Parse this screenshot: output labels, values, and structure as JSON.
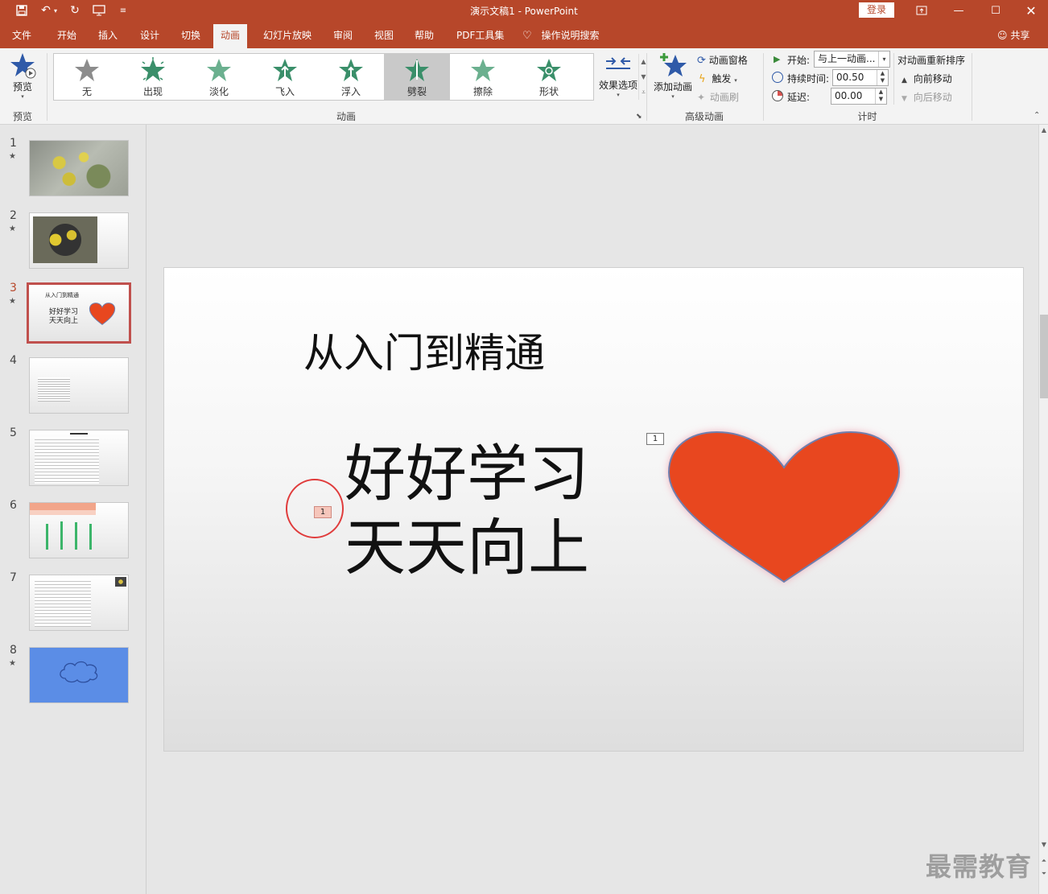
{
  "window": {
    "title": "演示文稿1  -  PowerPoint",
    "login_label": "登录"
  },
  "tabs": [
    {
      "label": "文件"
    },
    {
      "label": "开始"
    },
    {
      "label": "插入"
    },
    {
      "label": "设计"
    },
    {
      "label": "切换"
    },
    {
      "label": "动画",
      "active": true
    },
    {
      "label": "幻灯片放映"
    },
    {
      "label": "审阅"
    },
    {
      "label": "视图"
    },
    {
      "label": "帮助"
    },
    {
      "label": "PDF工具集"
    },
    {
      "label": "操作说明搜索"
    }
  ],
  "share_label": "共享",
  "ribbon": {
    "preview": {
      "button": "预览",
      "group": "预览"
    },
    "animations": {
      "group": "动画",
      "items": [
        {
          "label": "无",
          "icon": "star-gray-icon"
        },
        {
          "label": "出现",
          "icon": "star-burst-icon"
        },
        {
          "label": "淡化",
          "icon": "star-fade-icon"
        },
        {
          "label": "飞入",
          "icon": "star-fly-icon"
        },
        {
          "label": "浮入",
          "icon": "star-float-icon"
        },
        {
          "label": "劈裂",
          "icon": "star-split-icon",
          "selected": true
        },
        {
          "label": "擦除",
          "icon": "star-wipe-icon"
        },
        {
          "label": "形状",
          "icon": "star-shape-icon"
        }
      ],
      "effect_options": "效果选项"
    },
    "advanced": {
      "group": "高级动画",
      "add_animation": "添加动画",
      "pane": "动画窗格",
      "trigger": "触发",
      "painter": "动画刷"
    },
    "timing": {
      "group": "计时",
      "start_label": "开始:",
      "start_value": "与上一动画...",
      "duration_label": "持续时间:",
      "duration_value": "00.50",
      "delay_label": "延迟:",
      "delay_value": "00.00",
      "reorder": "对动画重新排序",
      "move_earlier": "向前移动",
      "move_later": "向后移动"
    }
  },
  "thumbnails": [
    {
      "number": "1",
      "star": true
    },
    {
      "number": "2",
      "star": true
    },
    {
      "number": "3",
      "star": true,
      "selected": true,
      "title": "从入门到精通",
      "line1": "好好学习",
      "line2": "天天向上"
    },
    {
      "number": "4",
      "star": false
    },
    {
      "number": "5",
      "star": false
    },
    {
      "number": "6",
      "star": false
    },
    {
      "number": "7",
      "star": false
    },
    {
      "number": "8",
      "star": true
    }
  ],
  "slide": {
    "title": "从入门到精通",
    "line1": "好好学习",
    "line2": "天天向上",
    "heart_tag": "1",
    "text_tag": "1",
    "heart_color": "#e8471f",
    "heart_outline": "#6f7fae"
  },
  "watermark": "最需教育",
  "colors": {
    "accent": "#b7472a",
    "selected_thumb_border": "#c0504d"
  }
}
